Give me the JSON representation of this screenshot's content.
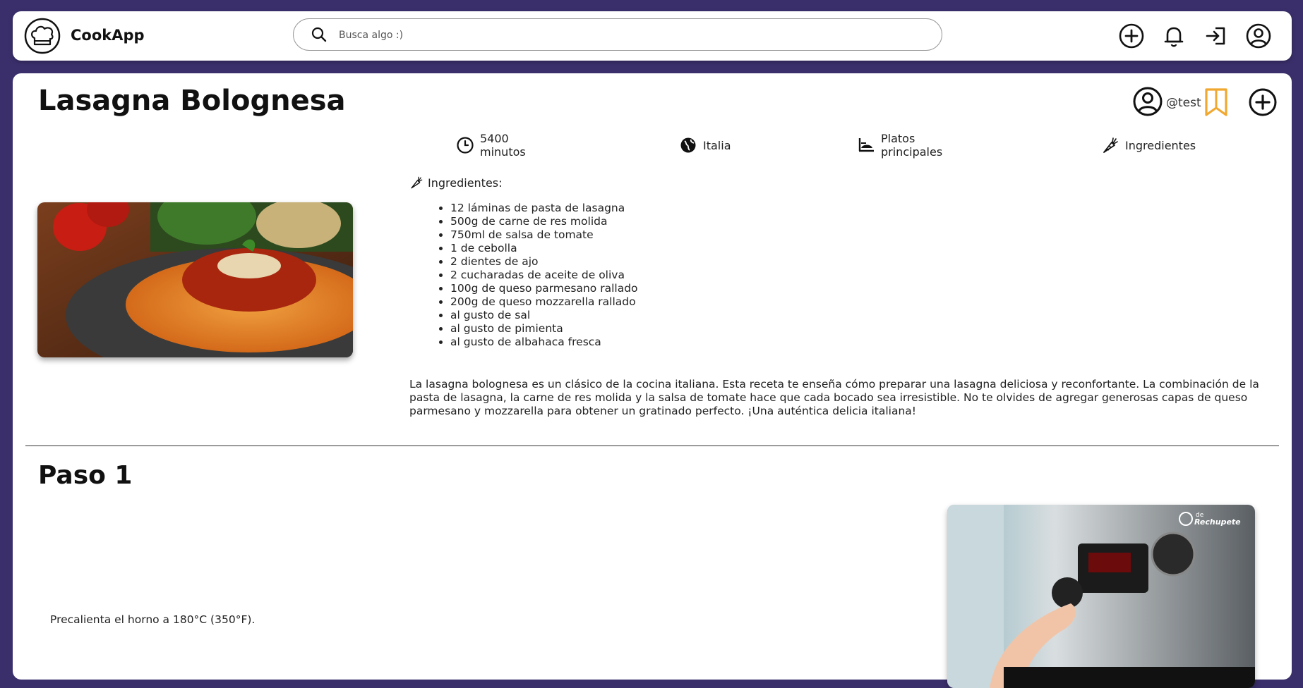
{
  "app": {
    "name": "CookApp"
  },
  "search": {
    "placeholder": "Busca algo :)"
  },
  "nav": {
    "icons": [
      "add-circle-icon",
      "bell-icon",
      "logout-icon",
      "user-circle-icon"
    ]
  },
  "recipe": {
    "title": "Lasagna Bolognesa",
    "author": "@test",
    "colors": {
      "bookmark": "#f0a830",
      "background": "#3a2f6b"
    },
    "meta": {
      "time_value": "5400",
      "time_unit": "minutos",
      "country": "Italia",
      "category_line1": "Platos",
      "category_line2": "principales",
      "ingredients_link": "Ingredientes"
    },
    "ingredients_heading": "Ingredientes:",
    "ingredients": [
      "12 láminas de pasta de lasagna",
      "500g de carne de res molida",
      "750ml de salsa de tomate",
      "1 de cebolla",
      "2 dientes de ajo",
      "2 cucharadas de aceite de oliva",
      "100g de queso parmesano rallado",
      "200g de queso mozzarella rallado",
      "al gusto de sal",
      "al gusto de pimienta",
      "al gusto de albahaca fresca"
    ],
    "description": "La lasagna bolognesa es un clásico de la cocina italiana. Esta receta te enseña cómo preparar una lasagna deliciosa y reconfortante. La combinación de la pasta de lasagna, la carne de res molida y la salsa de tomate hace que cada bocado sea irresistible. No te olvides de agregar generosas capas de queso parmesano y mozzarella para obtener un gratinado perfecto. ¡Una auténtica delicia italiana!"
  },
  "steps": [
    {
      "title": "Paso 1",
      "text": "Precalienta el horno a 180°C (350°F).",
      "watermark_line1": "de",
      "watermark_line2": "Rechupete"
    }
  ]
}
